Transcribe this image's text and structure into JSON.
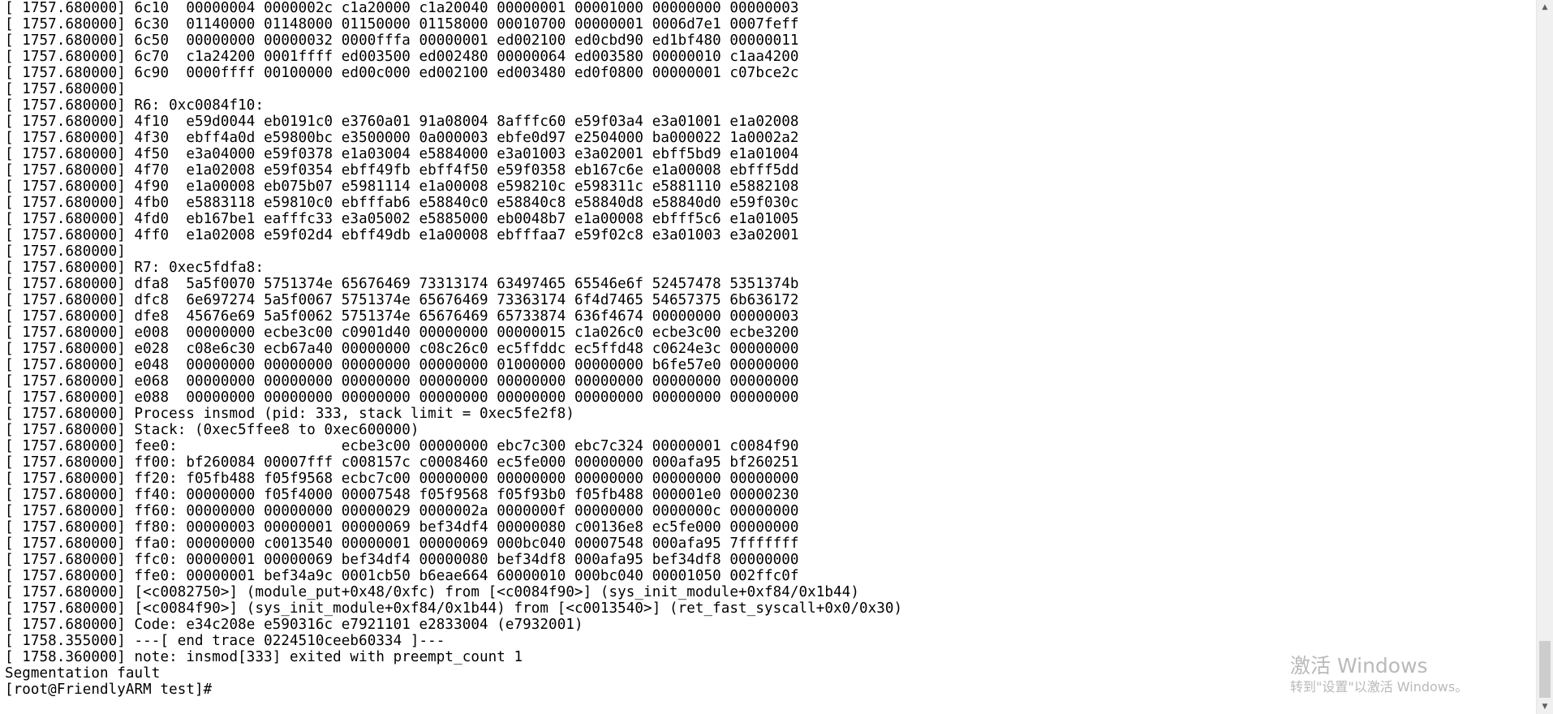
{
  "terminal": {
    "lines": [
      "[ 1757.680000] 6c10  00000004 0000002c c1a20000 c1a20040 00000001 00001000 00000000 00000003",
      "[ 1757.680000] 6c30  01140000 01148000 01150000 01158000 00010700 00000001 0006d7e1 0007feff",
      "[ 1757.680000] 6c50  00000000 00000032 0000fffa 00000001 ed002100 ed0cbd90 ed1bf480 00000011",
      "[ 1757.680000] 6c70  c1a24200 0001ffff ed003500 ed002480 00000064 ed003580 00000010 c1aa4200",
      "[ 1757.680000] 6c90  0000ffff 00100000 ed00c000 ed002100 ed003480 ed0f0800 00000001 c07bce2c",
      "[ 1757.680000]",
      "[ 1757.680000] R6: 0xc0084f10:",
      "[ 1757.680000] 4f10  e59d0044 eb0191c0 e3760a01 91a08004 8afffc60 e59f03a4 e3a01001 e1a02008",
      "[ 1757.680000] 4f30  ebff4a0d e59800bc e3500000 0a000003 ebfe0d97 e2504000 ba000022 1a0002a2",
      "[ 1757.680000] 4f50  e3a04000 e59f0378 e1a03004 e5884000 e3a01003 e3a02001 ebff5bd9 e1a01004",
      "[ 1757.680000] 4f70  e1a02008 e59f0354 ebff49fb ebff4f50 e59f0358 eb167c6e e1a00008 ebfff5dd",
      "[ 1757.680000] 4f90  e1a00008 eb075b07 e5981114 e1a00008 e598210c e598311c e5881110 e5882108",
      "[ 1757.680000] 4fb0  e5883118 e59810c0 ebfffab6 e58840c0 e58840c8 e58840d8 e58840d0 e59f030c",
      "[ 1757.680000] 4fd0  eb167be1 eafffc33 e3a05002 e5885000 eb0048b7 e1a00008 ebfff5c6 e1a01005",
      "[ 1757.680000] 4ff0  e1a02008 e59f02d4 ebff49db e1a00008 ebfffaa7 e59f02c8 e3a01003 e3a02001",
      "[ 1757.680000]",
      "[ 1757.680000] R7: 0xec5fdfa8:",
      "[ 1757.680000] dfa8  5a5f0070 5751374e 65676469 73313174 63497465 65546e6f 52457478 5351374b",
      "[ 1757.680000] dfc8  6e697274 5a5f0067 5751374e 65676469 73363174 6f4d7465 54657375 6b636172",
      "[ 1757.680000] dfe8  45676e69 5a5f0062 5751374e 65676469 65733874 636f4674 00000000 00000003",
      "[ 1757.680000] e008  00000000 ecbe3c00 c0901d40 00000000 00000015 c1a026c0 ecbe3c00 ecbe3200",
      "[ 1757.680000] e028  c08e6c30 ecb67a40 00000000 c08c26c0 ec5ffddc ec5ffd48 c0624e3c 00000000",
      "[ 1757.680000] e048  00000000 00000000 00000000 00000000 01000000 00000000 b6fe57e0 00000000",
      "[ 1757.680000] e068  00000000 00000000 00000000 00000000 00000000 00000000 00000000 00000000",
      "[ 1757.680000] e088  00000000 00000000 00000000 00000000 00000000 00000000 00000000 00000000",
      "[ 1757.680000] Process insmod (pid: 333, stack limit = 0xec5fe2f8)",
      "[ 1757.680000] Stack: (0xec5ffee8 to 0xec600000)",
      "[ 1757.680000] fee0:                   ecbe3c00 00000000 ebc7c300 ebc7c324 00000001 c0084f90",
      "[ 1757.680000] ff00: bf260084 00007fff c008157c c0008460 ec5fe000 00000000 000afa95 bf260251",
      "[ 1757.680000] ff20: f05fb488 f05f9568 ecbc7c00 00000000 00000000 00000000 00000000 00000000",
      "[ 1757.680000] ff40: 00000000 f05f4000 00007548 f05f9568 f05f93b0 f05fb488 000001e0 00000230",
      "[ 1757.680000] ff60: 00000000 00000000 00000029 0000002a 0000000f 00000000 0000000c 00000000",
      "[ 1757.680000] ff80: 00000003 00000001 00000069 bef34df4 00000080 c00136e8 ec5fe000 00000000",
      "[ 1757.680000] ffa0: 00000000 c0013540 00000001 00000069 000bc040 00007548 000afa95 7fffffff",
      "[ 1757.680000] ffc0: 00000001 00000069 bef34df4 00000080 bef34df8 000afa95 bef34df8 00000000",
      "[ 1757.680000] ffe0: 00000001 bef34a9c 0001cb50 b6eae664 60000010 000bc040 00001050 002ffc0f",
      "[ 1757.680000] [<c0082750>] (module_put+0x48/0xfc) from [<c0084f90>] (sys_init_module+0xf84/0x1b44)",
      "[ 1757.680000] [<c0084f90>] (sys_init_module+0xf84/0x1b44) from [<c0013540>] (ret_fast_syscall+0x0/0x30)",
      "[ 1757.680000] Code: e34c208e e590316c e7921101 e2833004 (e7932001)",
      "[ 1758.355000] ---[ end trace 0224510ceeb60334 ]---",
      "[ 1758.360000] note: insmod[333] exited with preempt_count 1",
      "Segmentation fault",
      "[root@FriendlyARM test]#"
    ]
  },
  "watermark": {
    "title": "激活 Windows",
    "subtitle": "转到\"设置\"以激活 Windows。"
  },
  "scrollbar": {
    "up_icon": "▲",
    "down_icon": "▼"
  },
  "colors": {
    "background": "#ffffff",
    "text": "#000000",
    "watermark": "#b9b9b9"
  }
}
